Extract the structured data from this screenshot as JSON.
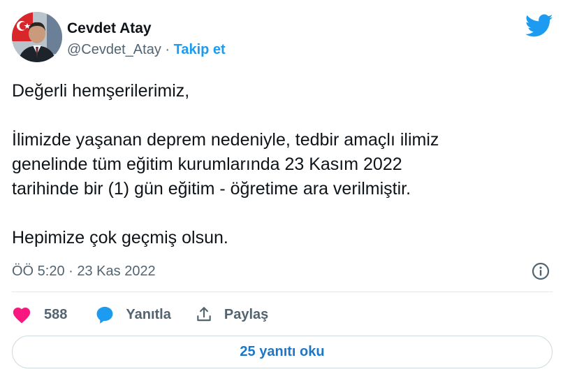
{
  "author": {
    "name": "Cevdet Atay",
    "handle": "@Cevdet_Atay",
    "separator": "·",
    "follow_label": "Takip et"
  },
  "tweet": {
    "paragraphs": [
      [
        "Değerli hemşerilerimiz,"
      ],
      [
        "İlimizde yaşanan deprem nedeniyle, tedbir amaçlı ilimiz",
        "genelinde tüm eğitim kurumlarında 23 Kasım 2022",
        "tarihinde bir (1) gün eğitim - öğretime ara verilmiştir."
      ],
      [
        "Hepimize çok geçmiş olsun."
      ]
    ],
    "timestamp": "ÖÖ 5:20 · 23 Kas 2022"
  },
  "actions": {
    "likes": "588",
    "reply_label": "Yanıtla",
    "share_label": "Paylaş"
  },
  "read_replies_label": "25 yanıtı oku",
  "colors": {
    "accent": "#1d9bf0",
    "like": "#f91880",
    "text": "#0f1419",
    "muted": "#536471"
  },
  "icons": {
    "brand": "twitter-bird-icon",
    "info": "info-icon",
    "like": "heart-icon",
    "reply": "speech-bubble-icon",
    "share": "share-icon"
  }
}
